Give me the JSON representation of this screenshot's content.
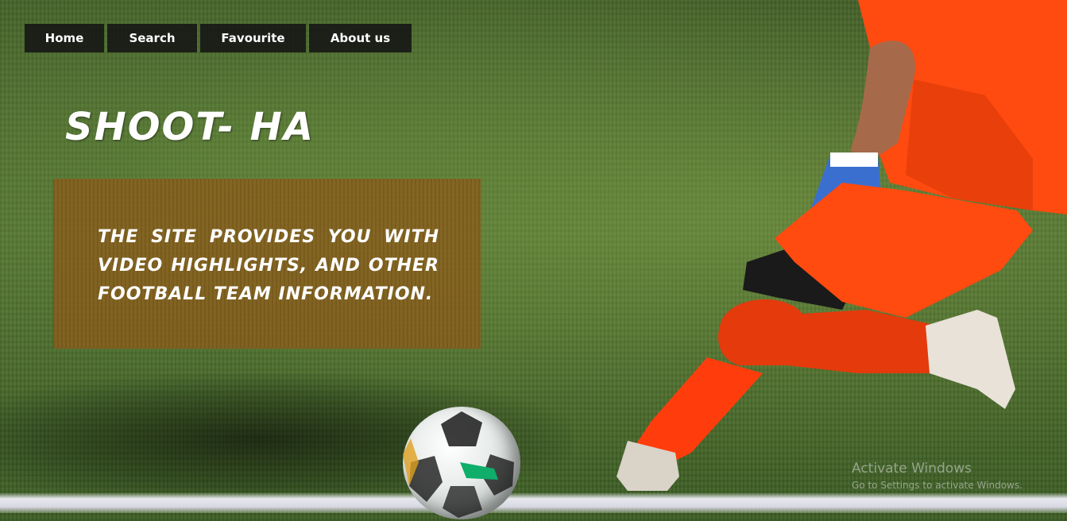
{
  "nav": {
    "items": [
      {
        "label": "Home"
      },
      {
        "label": "Search"
      },
      {
        "label": "Favourite"
      },
      {
        "label": "About us"
      }
    ]
  },
  "hero": {
    "title": "SHOOT- HA",
    "description": "THE SITE PROVIDES YOU WITH VIDEO HIGHLIGHTS, AND OTHER FOOTBALL TEAM INFORMATION."
  },
  "watermark": {
    "title": "Activate Windows",
    "subtitle": "Go to Settings to activate Windows."
  },
  "colors": {
    "nav_bg": "#141414",
    "info_box": "#855a19",
    "jersey": "#ff4a10",
    "grass": "#4f7030"
  }
}
